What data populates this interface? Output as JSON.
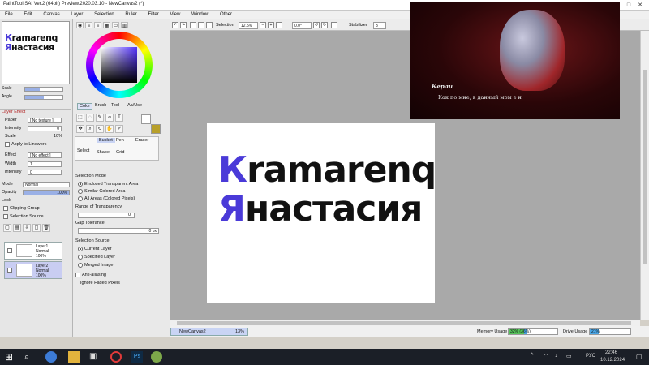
{
  "window": {
    "title": "PaintTool SAI Ver.2 (64bit) Preview.2020.03.10 - NewCanvas2 (*)"
  },
  "menu": [
    "File",
    "Edit",
    "Canvas",
    "Layer",
    "Selection",
    "Ruler",
    "Filter",
    "View",
    "Window",
    "Other"
  ],
  "toolbar": {
    "selection_label": "Selection",
    "zoom_value": "12.5%",
    "angle_value": "0.0°",
    "stabilizer_label": "Stabilizer",
    "stabilizer_value": "3"
  },
  "navigator": {
    "zoom_label": "Scale",
    "zoom_value": "12.5%",
    "angle_label": "Angle",
    "angle_value": "0°"
  },
  "layer_effect": {
    "header": "Layer Effect",
    "paper_label": "Paper",
    "paper_value": "[ No texture ]",
    "intensity_label": "Intensity",
    "intensity_value": "0",
    "scale_label": "Scale",
    "scale_value": "10%",
    "apply_lineworks": "Apply to Linework",
    "effect_label": "Effect",
    "effect_value": "[ No effect ]",
    "width_label": "Width",
    "width_value": "1",
    "intensity2_label": "Intensity",
    "intensity2_value": "0"
  },
  "layer_props": {
    "mode_label": "Mode",
    "mode_value": "Normal",
    "opacity_label": "Opacity",
    "opacity_value": "100%",
    "lock_label": "Lock",
    "clipping_group": "Clipping Group",
    "selection_source": "Selection Source"
  },
  "layers": [
    {
      "name": "Layer1",
      "mode": "Normal",
      "opacity": "100%",
      "selected": false
    },
    {
      "name": "Layer2",
      "mode": "Normal",
      "opacity": "100%",
      "selected": true
    }
  ],
  "color_tabs": [
    "Color",
    "Brush",
    "Tool",
    "Aa/Use"
  ],
  "tool_panel": {
    "selection_mode_label": "Selection Mode",
    "mode_options": [
      "Enclosed Transparent Area",
      "Similar Colored Area",
      "All Areas (Colored Pixels)"
    ],
    "range_label": "Range of Transparency",
    "range_value": "0",
    "gap_label": "Gap Tolerance",
    "gap_value": "0 px",
    "source_label": "Selection Source",
    "source_options": [
      "Current Layer",
      "Specified Layer",
      "Merged Image"
    ],
    "antialiasing": "Anti-aliasing",
    "ignore_pixels": "Ignore Faded Pixels"
  },
  "tool_tabs": [
    "Select",
    "Bucket",
    "Pen",
    "Eraser",
    "Shape",
    "Grid"
  ],
  "document": {
    "line1_first": "К",
    "line1_rest": "ramarenq",
    "line2_first": "Я",
    "line2_rest": "настасия",
    "accent_color": "#4a3ad8"
  },
  "overlay": {
    "speaker": "Кёрли",
    "subtitle": "Как по мне, в данный мом е н"
  },
  "statusbar": {
    "tab_name": "NewCanvas2",
    "tab_zoom": "13%",
    "memory_label": "Memory Usage",
    "memory_value": "32% (36%)",
    "drive_label": "Drive Usage",
    "drive_value": "21%"
  },
  "taskbar": {
    "lang": "РУС",
    "time": "22:46",
    "date": "10.12.2024"
  }
}
